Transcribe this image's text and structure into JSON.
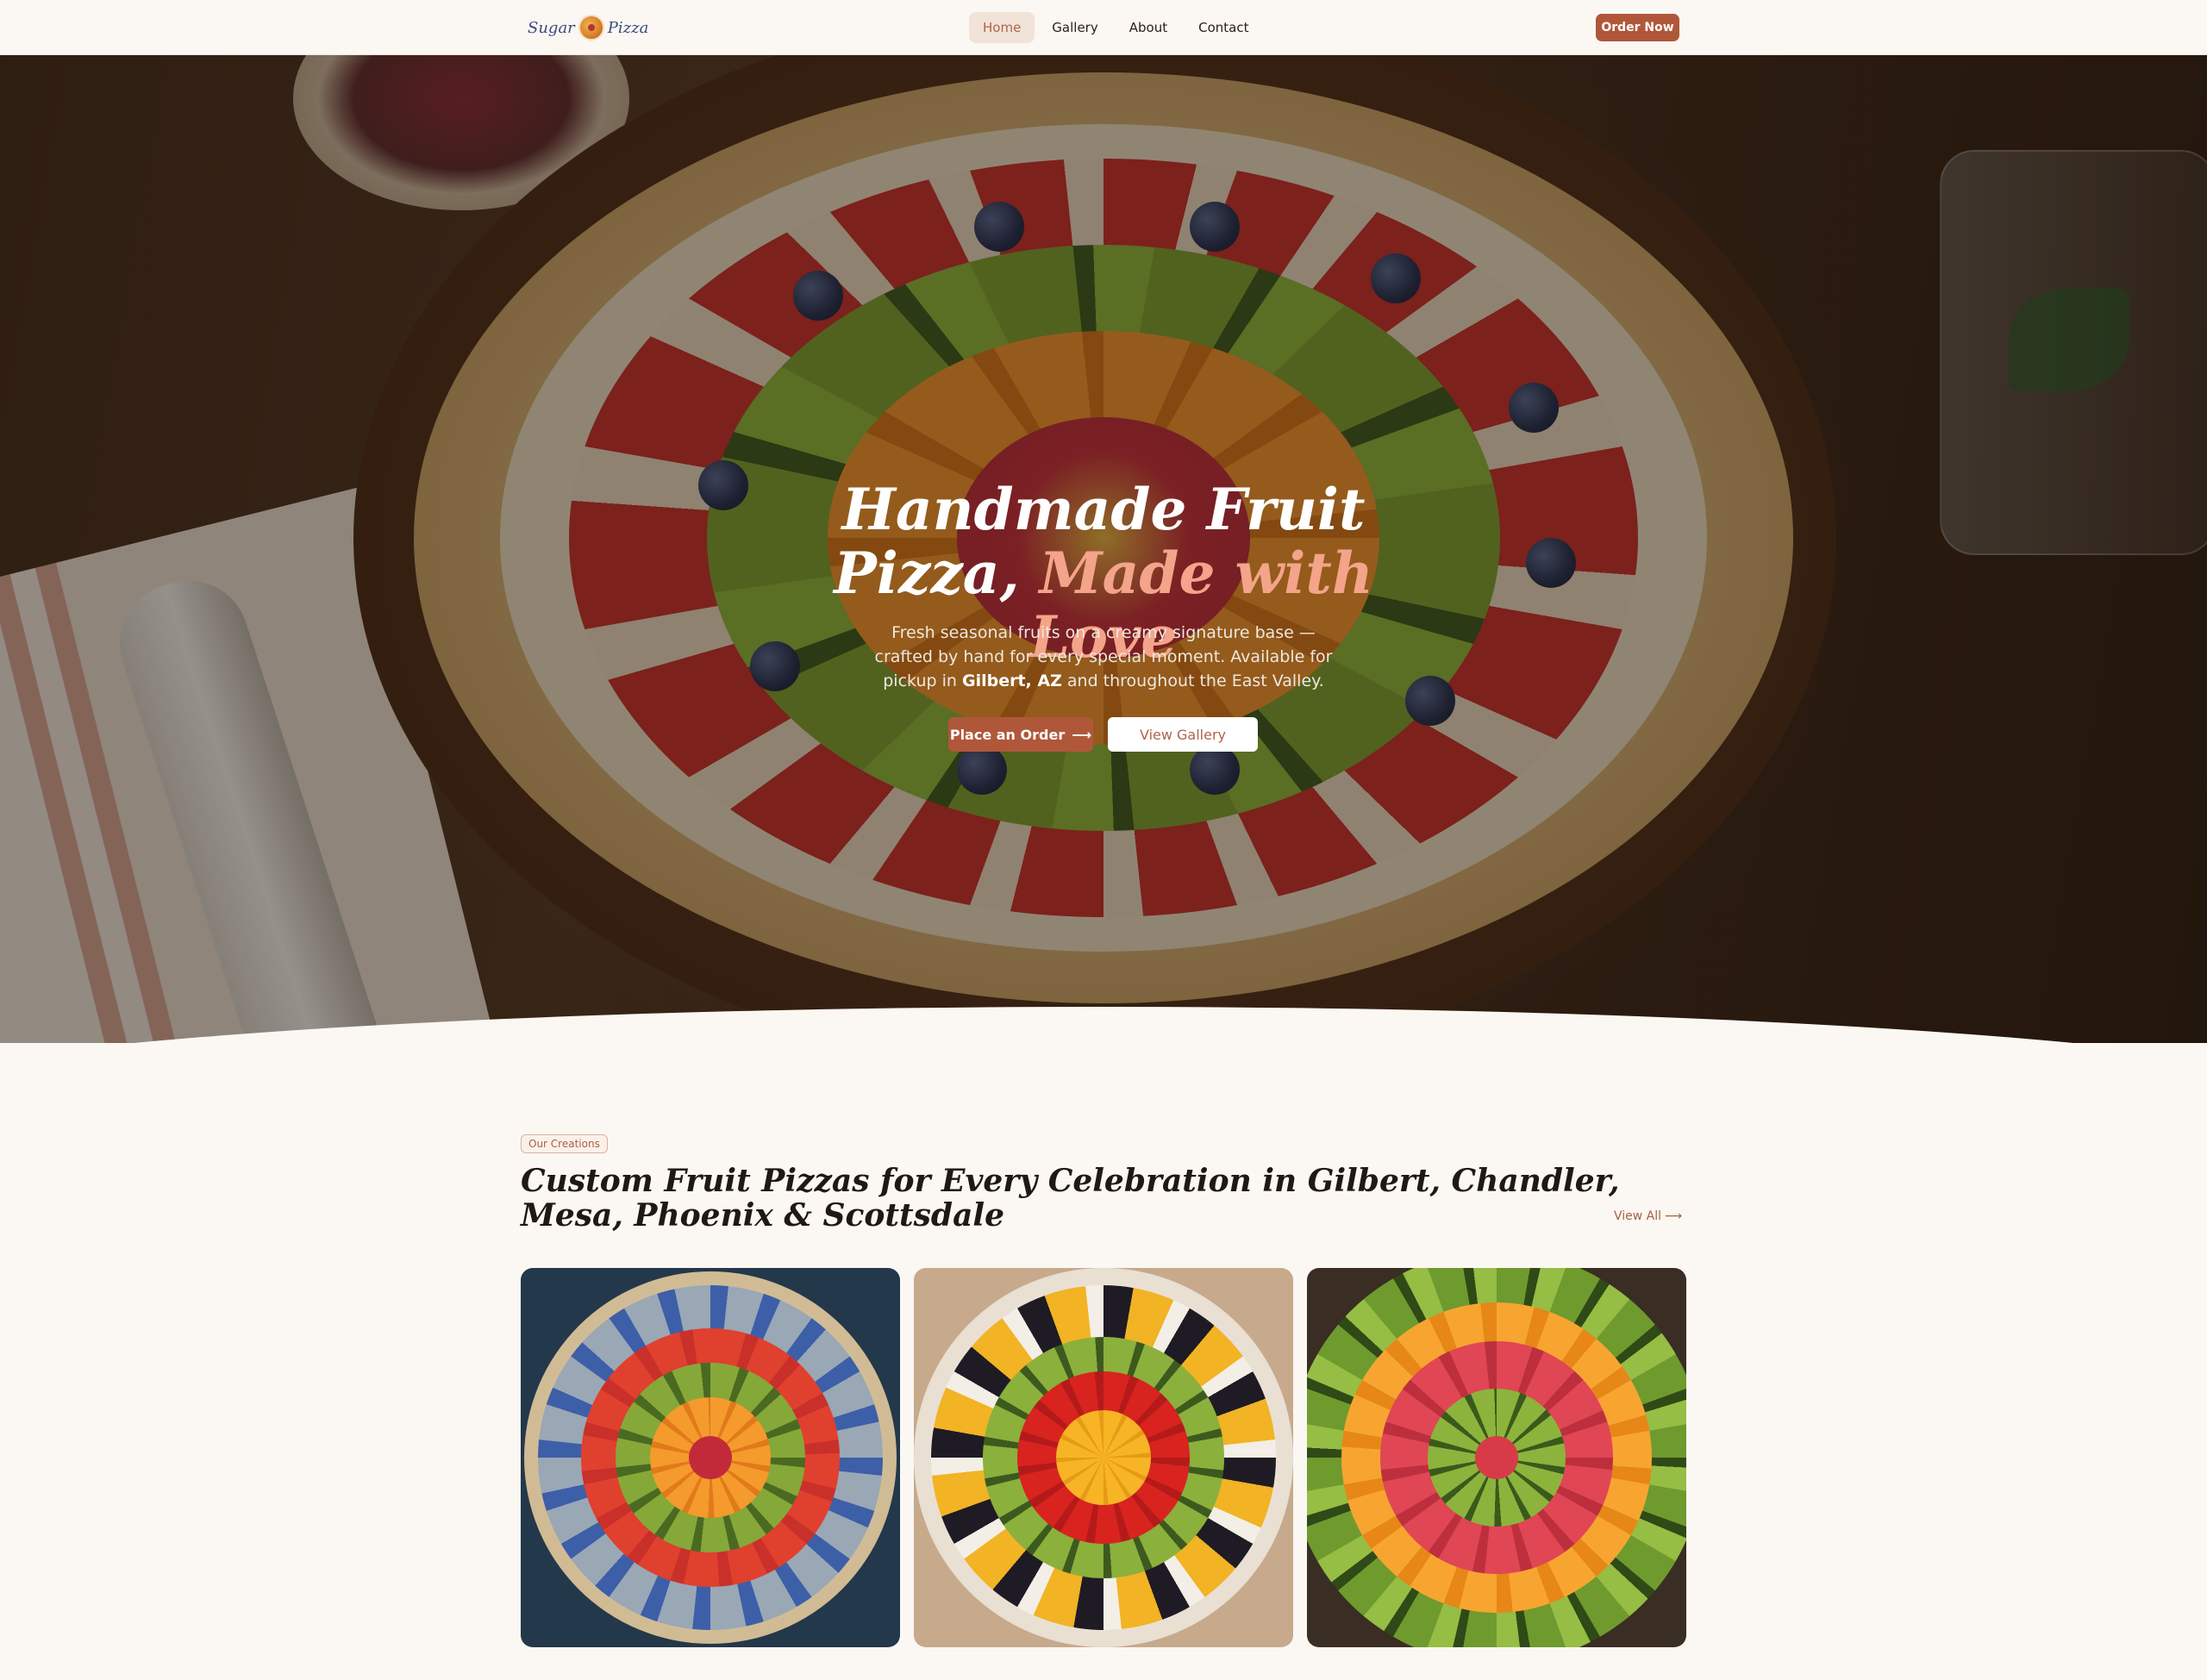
{
  "nav": {
    "logo_left": "Sugar",
    "logo_right": "Pizza",
    "links": [
      {
        "label": "Home",
        "active": true
      },
      {
        "label": "Gallery",
        "active": false
      },
      {
        "label": "About",
        "active": false
      },
      {
        "label": "Contact",
        "active": false
      }
    ],
    "cta": "Order Now"
  },
  "hero": {
    "title_line1": "Handmade Fruit",
    "title_line2_a": "Pizza, ",
    "title_line2_b": "Made with Love",
    "subtitle_a": "Fresh seasonal fruits on a creamy signature base — crafted by hand for every special moment. Available for pickup in ",
    "subtitle_bold": "Gilbert, AZ",
    "subtitle_b": " and throughout the East Valley.",
    "primary_button": "Place an Order",
    "secondary_button": "View Gallery"
  },
  "creations": {
    "badge": "Our Creations",
    "title": "Custom Fruit Pizzas for Every Celebration in Gilbert, Chandler, Mesa, Phoenix & Scottsdale",
    "view_all": "View All"
  },
  "icons": {
    "arrow": "arrow-right-icon"
  },
  "colors": {
    "accent": "#b0573a",
    "accent_soft": "#f4a48a",
    "background": "#fbf7f2"
  }
}
